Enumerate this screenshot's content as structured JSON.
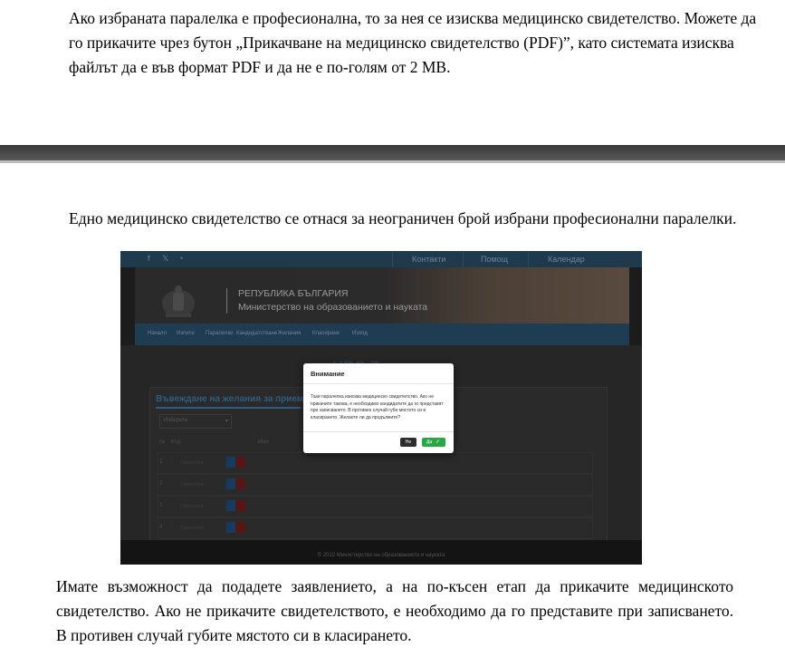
{
  "doc": {
    "paragraph_1": "Ако избраната паралелка е професионална, то за нея се изисква медицинско свидетелство. Можете да го прикачите чрез бутон „Прикачване на медицинско свидетелство (PDF)”, като системата изисква файлът да е във формат PDF и да не е по-голям от 2 MB.",
    "paragraph_2": "Едно медицинско свидетелство се отнася за неограничен брой избрани професионални паралелки.",
    "paragraph_3": "Имате възможност да подадете заявлението, а на по-късен етап да прикачите медицинското свидетелство. Ако не прикачите свидетелството, е необходимо да го представите при записването. В противен случай губите мястото си в класирането."
  },
  "screenshot": {
    "topbar": {
      "social_icons": [
        "facebook-icon",
        "twitter-icon",
        "rss-icon"
      ],
      "links": [
        "Контакти",
        "Помощ",
        "Календар"
      ]
    },
    "header": {
      "republic": "РЕПУБЛИКА БЪЛГАРИЯ",
      "ministry": "Министерство на образованието и науката"
    },
    "nav": [
      "Начало",
      "Изпити",
      "Паралелки",
      "Кандидатстване",
      "Желания",
      "Класиране",
      "Изход"
    ],
    "page_title": "НВО 7. клас",
    "panel_title": "Въвеждане на желания за прием",
    "select_value": "Изберете",
    "table_headers": [
      "№",
      "Код",
      "Име"
    ],
    "row_numbers": [
      "1",
      "2",
      "3",
      "4"
    ],
    "row_placeholder": "Паралелка",
    "footer": "© 2022 Министерство на образованието и науката",
    "modal": {
      "title": "Внимание",
      "body": "Тази паралелка изисква медицинско свидетелство. Ако не прикачите такова, е необходимо кандидатите да го представят при записването. В противен случай губи мястото си в класирането. Желаете ли да продължите?",
      "no_label": "Не",
      "yes_label": "Да"
    }
  },
  "colors": {
    "topbar": "#1f3a4c",
    "navbar": "#1e3c52",
    "yes_button": "#29a745",
    "no_button": "#2d2d2d",
    "divider": "#3a3a3a"
  }
}
